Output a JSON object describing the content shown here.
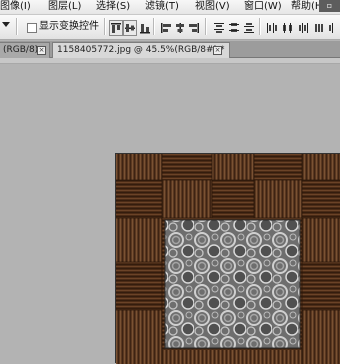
{
  "menubar": {
    "items": [
      "图像(I)",
      "图层(L)",
      "选择(S)",
      "滤镜(T)",
      "视图(V)",
      "窗口(W)",
      "帮助(H)"
    ],
    "ps_control": "▫"
  },
  "options_bar": {
    "show_transform_label": "显示变换控件",
    "show_transform_checked": false,
    "align_icons": [
      "align-top-edges-icon",
      "align-vertical-centers-icon",
      "align-bottom-edges-icon",
      "align-left-edges-icon",
      "align-horizontal-centers-icon",
      "align-right-edges-icon"
    ],
    "distribute_icons": [
      "distribute-top-icon",
      "distribute-vcenter-icon",
      "distribute-bottom-icon",
      "distribute-left-icon",
      "distribute-hcenter-icon",
      "distribute-right-icon"
    ]
  },
  "tabs": [
    {
      "label": "(RGB/8)",
      "close": "×",
      "active": false
    },
    {
      "label": "1158405772.jpg @ 45.5%(RGB/8#) *",
      "close": "×",
      "active": true
    }
  ],
  "colors": {
    "workspace": "#b3b3b3",
    "wood_dark": "#3e2412",
    "wood_mid": "#6a4126",
    "fabric": "#8c8c8c"
  }
}
